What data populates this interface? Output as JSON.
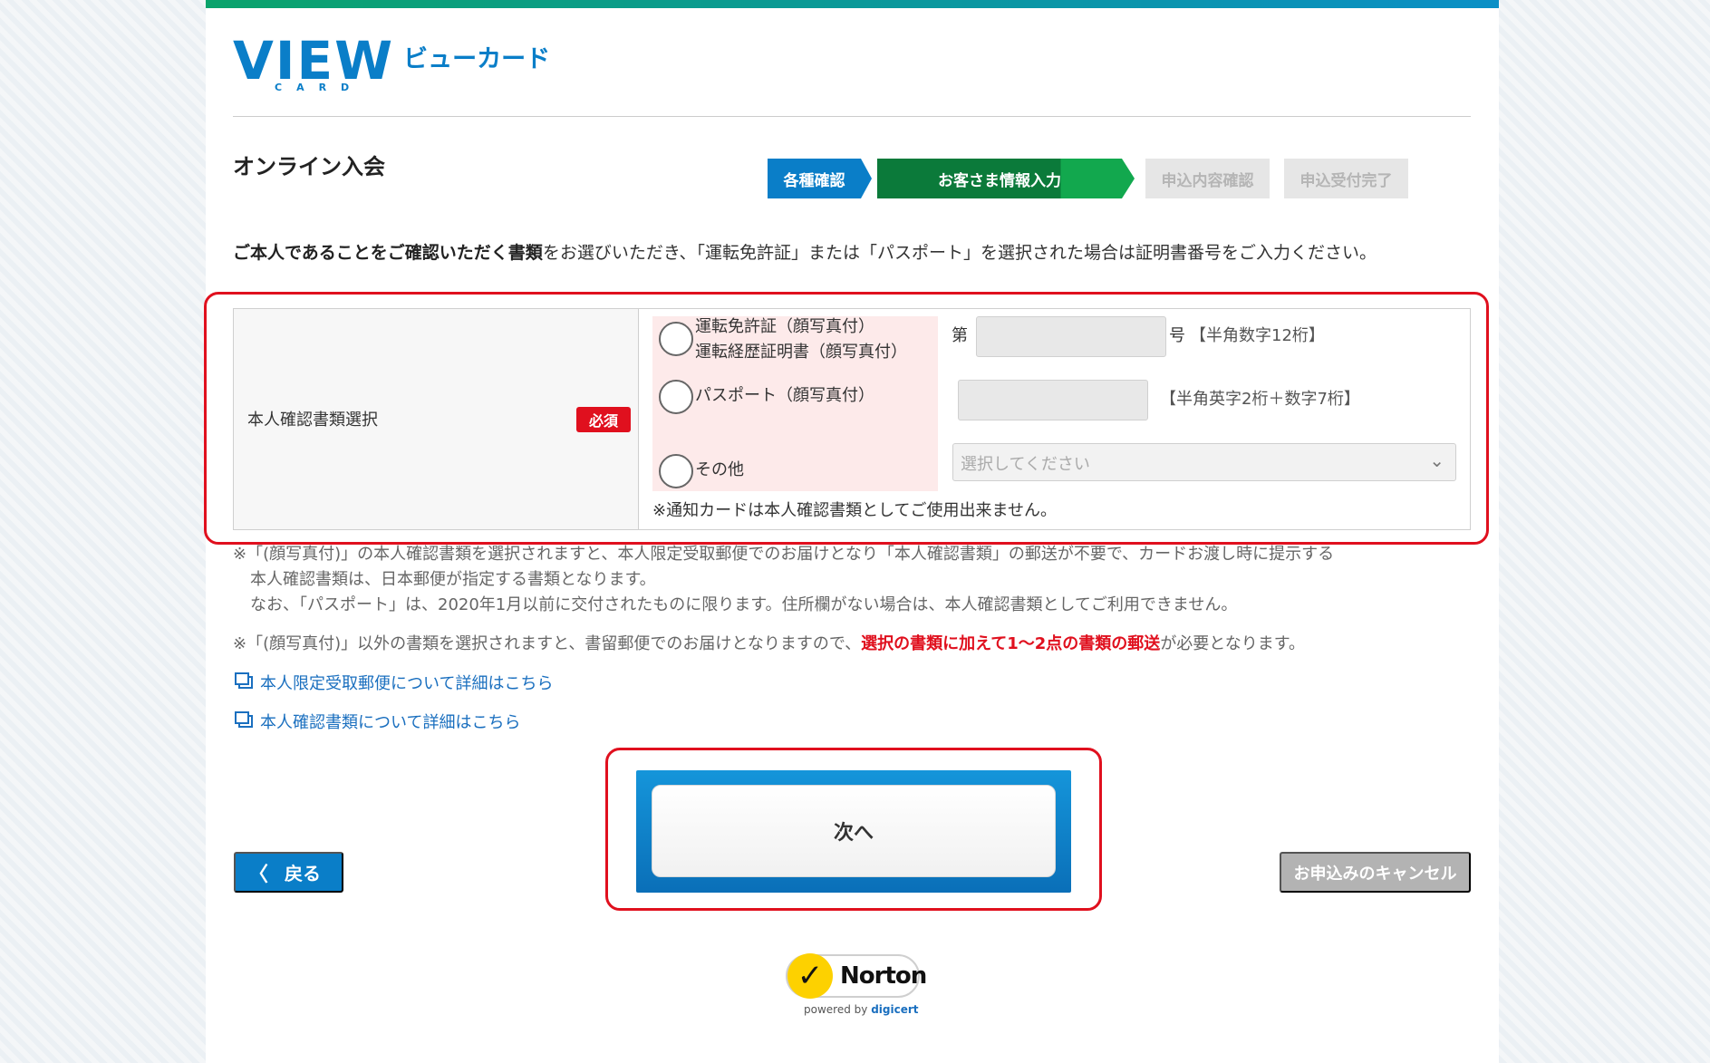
{
  "brand": {
    "logo_main": "VIEW",
    "logo_sub": "CARD",
    "logo_jp": "ビューカード"
  },
  "page": {
    "title": "オンライン入会"
  },
  "steps": [
    {
      "label": "各種確認"
    },
    {
      "label": "お客さま情報入力"
    },
    {
      "label": "申込内容確認"
    },
    {
      "label": "申込受付完了"
    }
  ],
  "intro": {
    "bold": "ご本人であることをご確認いただく書類",
    "rest": "をお選びいただき、「運転免許証」または「パスポート」を選択された場合は証明書番号をご入力ください。"
  },
  "form": {
    "label": "本人確認書類選択",
    "required": "必須",
    "options": [
      {
        "line1": "運転免許証（顔写真付）",
        "line2": "運転経歴証明書（顔写真付）"
      },
      {
        "line1": "パスポート（顔写真付）"
      },
      {
        "line1": "その他"
      }
    ],
    "license": {
      "prefix": "第",
      "suffix": "号",
      "hint": "【半角数字12桁】",
      "value": ""
    },
    "passport": {
      "hint": "【半角英字2桁＋数字7桁】",
      "value": ""
    },
    "select": {
      "placeholder": "選択してください"
    },
    "card_notice": "※通知カードは本人確認書類としてご使用出来ません。"
  },
  "notes": {
    "n1_line1": "※「(顔写真付)」の本人確認書類を選択されますと、本人限定受取郵便でのお届けとなり「本人確認書類」の郵送が不要で、カードお渡し時に提示する",
    "n1_line2": "本人確認書類は、日本郵便が指定する書類となります。",
    "n1_line3": "なお、「パスポート」は、2020年1月以前に交付されたものに限ります。住所欄がない場合は、本人確認書類としてご利用できません。",
    "n2_pre": "※「(顔写真付)」以外の書類を選択されますと、書留郵便でのお届けとなりますので、",
    "n2_red": "選択の書類に加えて1～2点の書類の郵送",
    "n2_post": "が必要となります。"
  },
  "links": {
    "l1": "本人限定受取郵便について詳細はこちら",
    "l2": "本人確認書類について詳細はこちら"
  },
  "buttons": {
    "next": "次へ",
    "back": "戻る",
    "cancel": "お申込みのキャンセル"
  },
  "norton": {
    "name": "Norton",
    "powered_by": "powered by",
    "vendor": "digicert"
  },
  "colors": {
    "primary": "#0a7ec8",
    "active_step": "#0b7a3a",
    "required": "#e0101e",
    "link": "#1a6fbf"
  }
}
